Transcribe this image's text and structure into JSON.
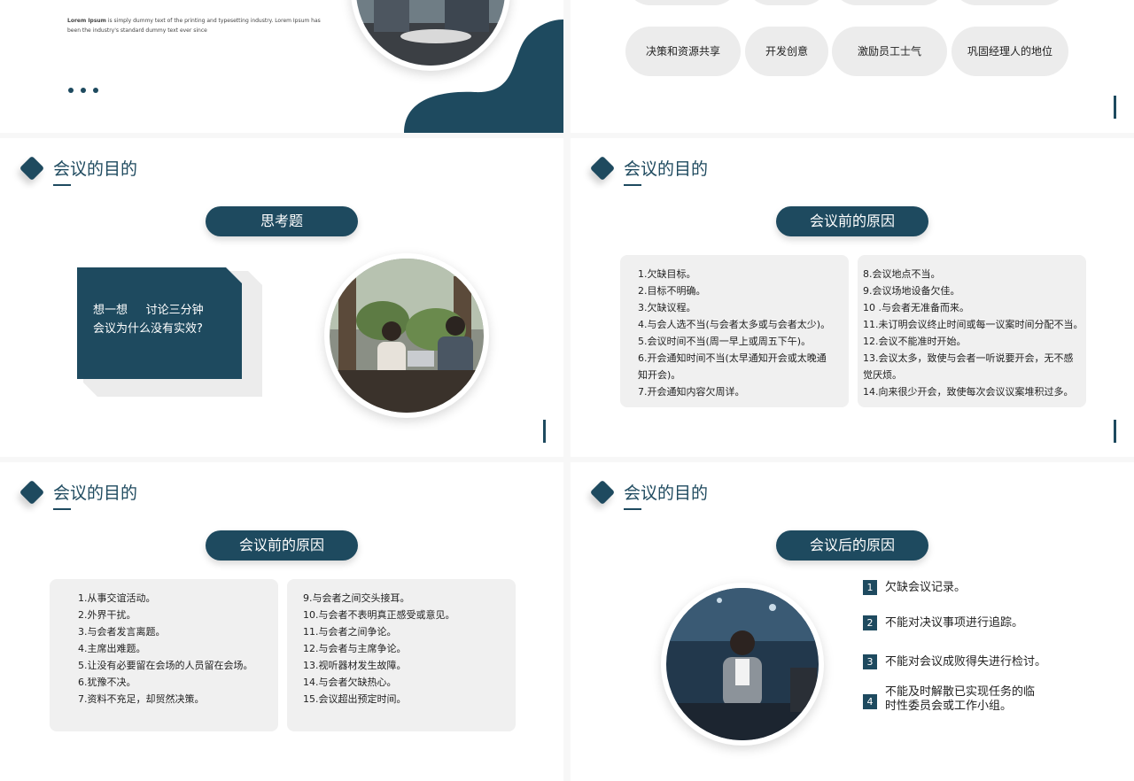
{
  "section_title": "会议的目的",
  "slide1": {
    "intro_bold": "Lorem Ipsum",
    "intro_text": " is simply dummy text of the printing and typesetting industry. Lorem Ipsum has been the industry's standard dummy text ever since"
  },
  "slide2": {
    "chips_top": [
      "",
      "",
      "",
      ""
    ],
    "chips": [
      "决策和资源共享",
      "开发创意",
      "激励员工士气",
      "巩固经理人的地位"
    ]
  },
  "slide3": {
    "pill": "思考题",
    "card_line1": "想一想     讨论三分钟",
    "card_line2": "会议为什么没有实效?"
  },
  "slide4": {
    "pill": "会议前的原因",
    "left": [
      "1.欠缺目标。",
      "2.目标不明确。",
      "3.欠缺议程。",
      "4.与会人选不当(与会者太多或与会者太少)。",
      "5.会议时间不当(周一早上或周五下午)。",
      "6.开会通知时间不当(太早通知开会或太晚通知开会)。",
      "7.开会通知内容欠周详。"
    ],
    "right": [
      "8.会议地点不当。",
      "9.会议场地设备欠佳。",
      "10 .与会者无准备而来。",
      "11.未订明会议终止时间或每一议案时间分配不当。",
      "12.会议不能准时开始。",
      "13.会议太多，致使与会者一听说要开会，无不感觉厌烦。",
      "14.向来很少开会，致使每次会议议案堆积过多。"
    ]
  },
  "slide5": {
    "pill": "会议前的原因",
    "left": [
      "1.从事交谊活动。",
      "2.外界干扰。",
      "3.与会者发言离题。",
      "4.主席出难题。",
      "5.让没有必要留在会场的人员留在会场。",
      "6.犹豫不决。",
      "7.资料不充足，却贸然决策。"
    ],
    "right": [
      "9.与会者之间交头接耳。",
      "10.与会者不表明真正感受或意见。",
      "11.与会者之间争论。",
      "12.与会者与主席争论。",
      "13.视听器材发生故障。",
      "14.与会者欠缺热心。",
      "15.会议超出预定时间。"
    ]
  },
  "slide6": {
    "pill": "会议后的原因",
    "items": [
      {
        "num": "1",
        "text": "欠缺会议记录。"
      },
      {
        "num": "2",
        "text": "不能对决议事项进行追踪。"
      },
      {
        "num": "3",
        "text": "不能对会议成败得失进行检讨。"
      },
      {
        "num": "4",
        "text": "不能及时解散已实现任务的临时性委员会或工作小组。"
      }
    ]
  },
  "colors": {
    "accent": "#1e4a5f",
    "chip": "#ececec",
    "box": "#f0f0f0"
  }
}
